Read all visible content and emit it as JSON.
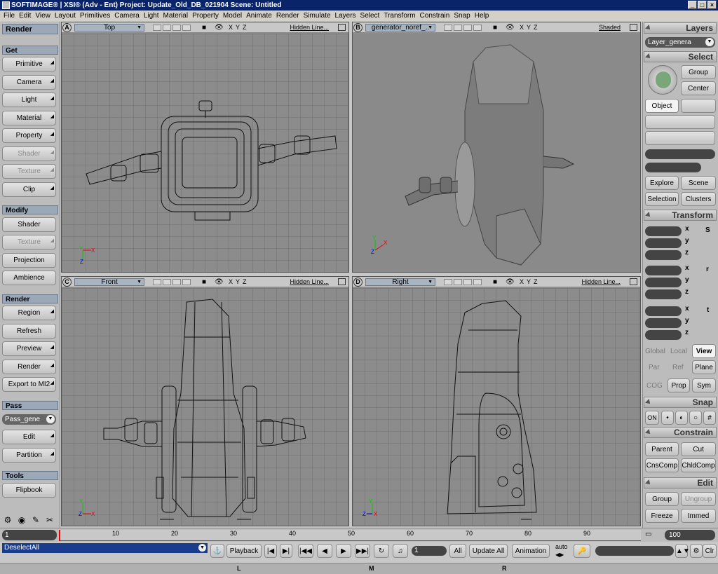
{
  "window": {
    "title": "SOFTIMAGE® | XSI® (Adv - Ent) Project: Update_Old_DB_021904    Scene: Untitled",
    "min": "_",
    "max": "□",
    "close": "×"
  },
  "menu": [
    "File",
    "Edit",
    "View",
    "Layout",
    "Primitives",
    "Camera",
    "Light",
    "Material",
    "Property",
    "Model",
    "Animate",
    "Render",
    "Simulate",
    "Layers",
    "Select",
    "Transform",
    "Constrain",
    "Snap",
    "Help"
  ],
  "left": {
    "title": "Render",
    "get": {
      "header": "Get",
      "buttons": [
        "Primitive",
        "Camera",
        "Light",
        "Material",
        "Property",
        "Shader",
        "Texture",
        "Clip"
      ]
    },
    "modify": {
      "header": "Modify",
      "buttons": [
        "Shader",
        "Texture",
        "Projection",
        "Ambience"
      ]
    },
    "render": {
      "header": "Render",
      "buttons": [
        "Region",
        "Refresh",
        "Preview",
        "Render",
        "Export to MI2"
      ]
    },
    "pass": {
      "header": "Pass",
      "dropdown": "Pass_gene",
      "buttons": [
        "Edit",
        "Partition"
      ]
    },
    "tools": {
      "header": "Tools",
      "buttons": [
        "Flipbook"
      ]
    }
  },
  "viewports": [
    {
      "letter": "A",
      "camera": "Top",
      "mode": "Hidden Line..."
    },
    {
      "letter": "B",
      "camera": "generator_noref_..",
      "mode": "Shaded"
    },
    {
      "letter": "C",
      "camera": "Front",
      "mode": "Hidden Line..."
    },
    {
      "letter": "D",
      "camera": "Right",
      "mode": "Hidden Line..."
    }
  ],
  "axes": {
    "x": "X",
    "y": "Y",
    "z": "Z"
  },
  "vp_axis_labels": [
    "X",
    "Y",
    "Z"
  ],
  "right": {
    "layers": {
      "header": "Layers",
      "dropdown": "Layer_genera"
    },
    "select": {
      "header": "Select",
      "group": "Group",
      "center": "Center",
      "object": "Object",
      "explore": "Explore",
      "scene": "Scene",
      "selection": "Selection",
      "clusters": "Clusters"
    },
    "transform": {
      "header": "Transform",
      "labels": [
        "x",
        "y",
        "z"
      ],
      "icons": [
        "S",
        "r",
        "t"
      ],
      "global": "Global",
      "local": "Local",
      "view": "View",
      "par": "Par",
      "ref": "Ref",
      "plane": "Plane",
      "cog": "COG",
      "prop": "Prop",
      "sym": "Sym"
    },
    "snap": {
      "header": "Snap",
      "on": "ON"
    },
    "constrain": {
      "header": "Constrain",
      "parent": "Parent",
      "cut": "Cut",
      "cnscomp": "CnsComp",
      "chldcomp": "ChldComp"
    },
    "edit": {
      "header": "Edit",
      "group": "Group",
      "ungroup": "Ungroup",
      "freeze": "Freeze",
      "immed": "Immed"
    }
  },
  "timeline": {
    "start": "1",
    "end": "100",
    "ticks": [
      "10",
      "20",
      "30",
      "40",
      "50",
      "60",
      "70",
      "80",
      "90"
    ]
  },
  "bottom": {
    "command": "DeselectAll",
    "playback": "Playback",
    "frame": "1",
    "all": "All",
    "update_all": "Update All",
    "animation": "Animation",
    "auto": "auto",
    "clr": "Clr"
  },
  "status": {
    "l": "L",
    "m": "M",
    "r": "R"
  }
}
